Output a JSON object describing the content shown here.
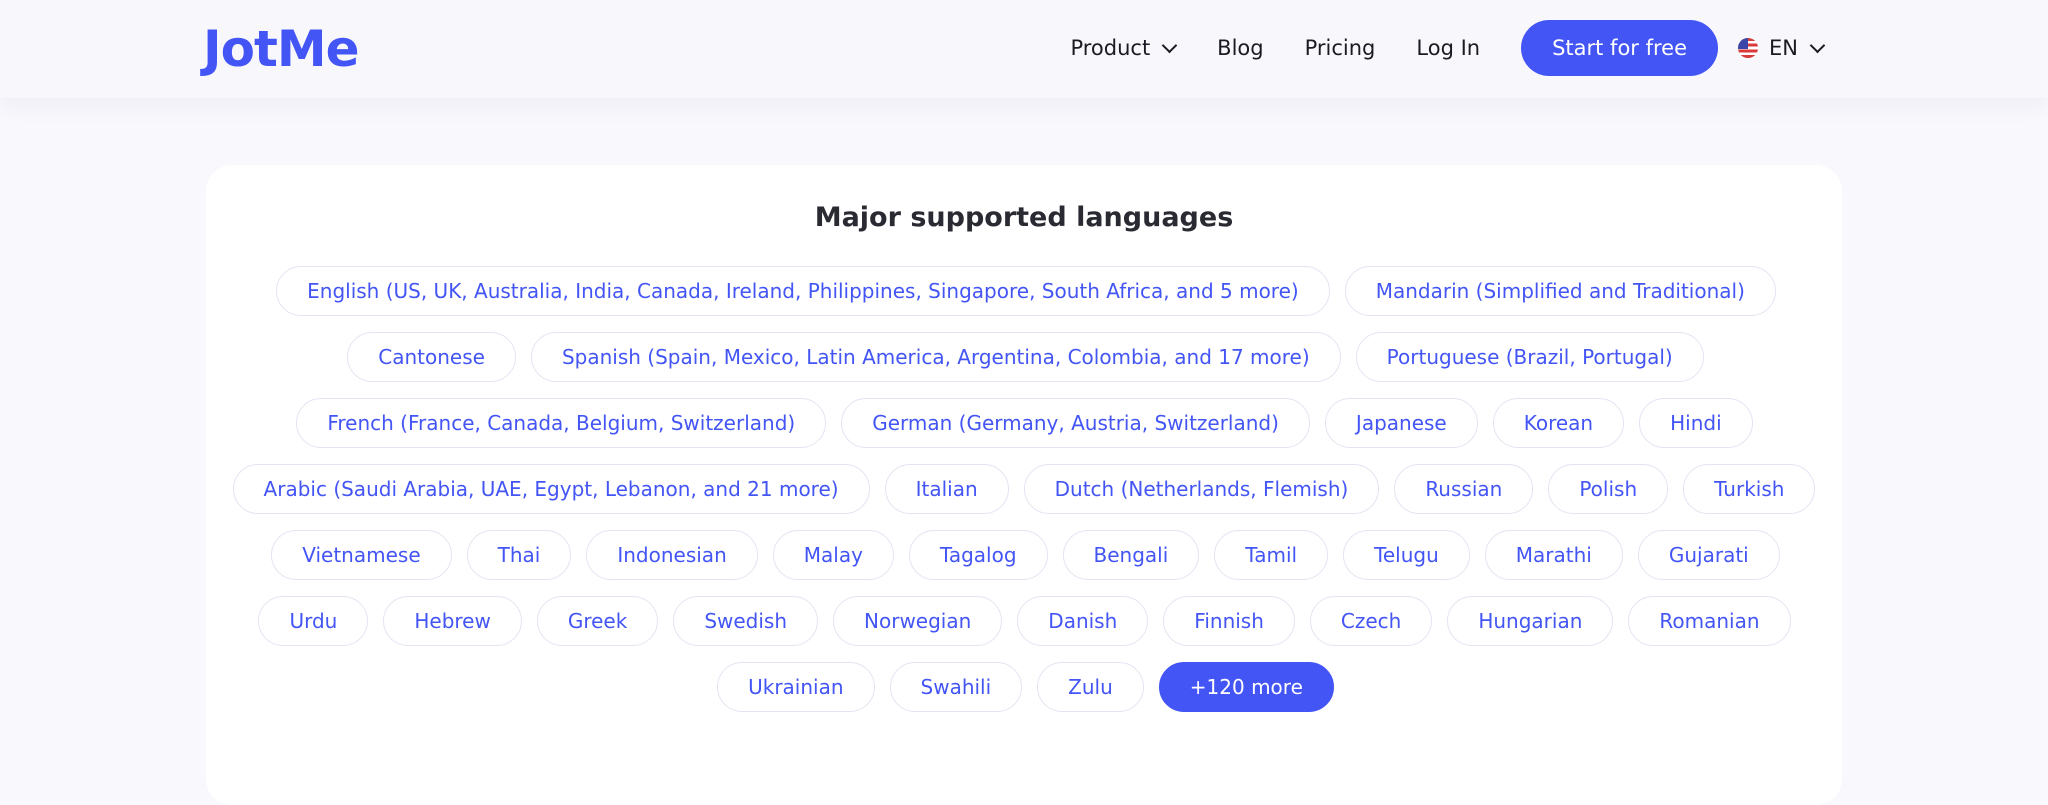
{
  "header": {
    "logo": "JotMe",
    "nav": {
      "product": "Product",
      "blog": "Blog",
      "pricing": "Pricing",
      "login": "Log In"
    },
    "cta": "Start for free",
    "language": "EN"
  },
  "section": {
    "title": "Major supported languages",
    "rows": [
      [
        "English (US, UK, Australia, India, Canada, Ireland, Philippines, Singapore, South Africa, and 5 more)",
        "Mandarin (Simplified and Traditional)"
      ],
      [
        "Cantonese",
        "Spanish (Spain, Mexico, Latin America, Argentina, Colombia, and 17 more)",
        "Portuguese (Brazil, Portugal)"
      ],
      [
        "French (France, Canada, Belgium, Switzerland)",
        "German (Germany, Austria, Switzerland)",
        "Japanese",
        "Korean",
        "Hindi"
      ],
      [
        "Arabic (Saudi Arabia, UAE, Egypt, Lebanon, and 21 more)",
        "Italian",
        "Dutch (Netherlands, Flemish)",
        "Russian",
        "Polish",
        "Turkish"
      ],
      [
        "Vietnamese",
        "Thai",
        "Indonesian",
        "Malay",
        "Tagalog",
        "Bengali",
        "Tamil",
        "Telugu",
        "Marathi",
        "Gujarati"
      ],
      [
        "Urdu",
        "Hebrew",
        "Greek",
        "Swedish",
        "Norwegian",
        "Danish",
        "Finnish",
        "Czech",
        "Hungarian",
        "Romanian"
      ],
      [
        "Ukrainian",
        "Swahili",
        "Zulu"
      ]
    ],
    "more_label": "+120 more"
  },
  "colors": {
    "accent": "#4355f5",
    "background": "#f8f8fd",
    "card": "#ffffff",
    "chip_border": "#e3e4f2",
    "text_dark": "#1a1a22"
  },
  "icons": {
    "dropdown": "chevron-down-icon",
    "flag": "us-flag-icon"
  }
}
